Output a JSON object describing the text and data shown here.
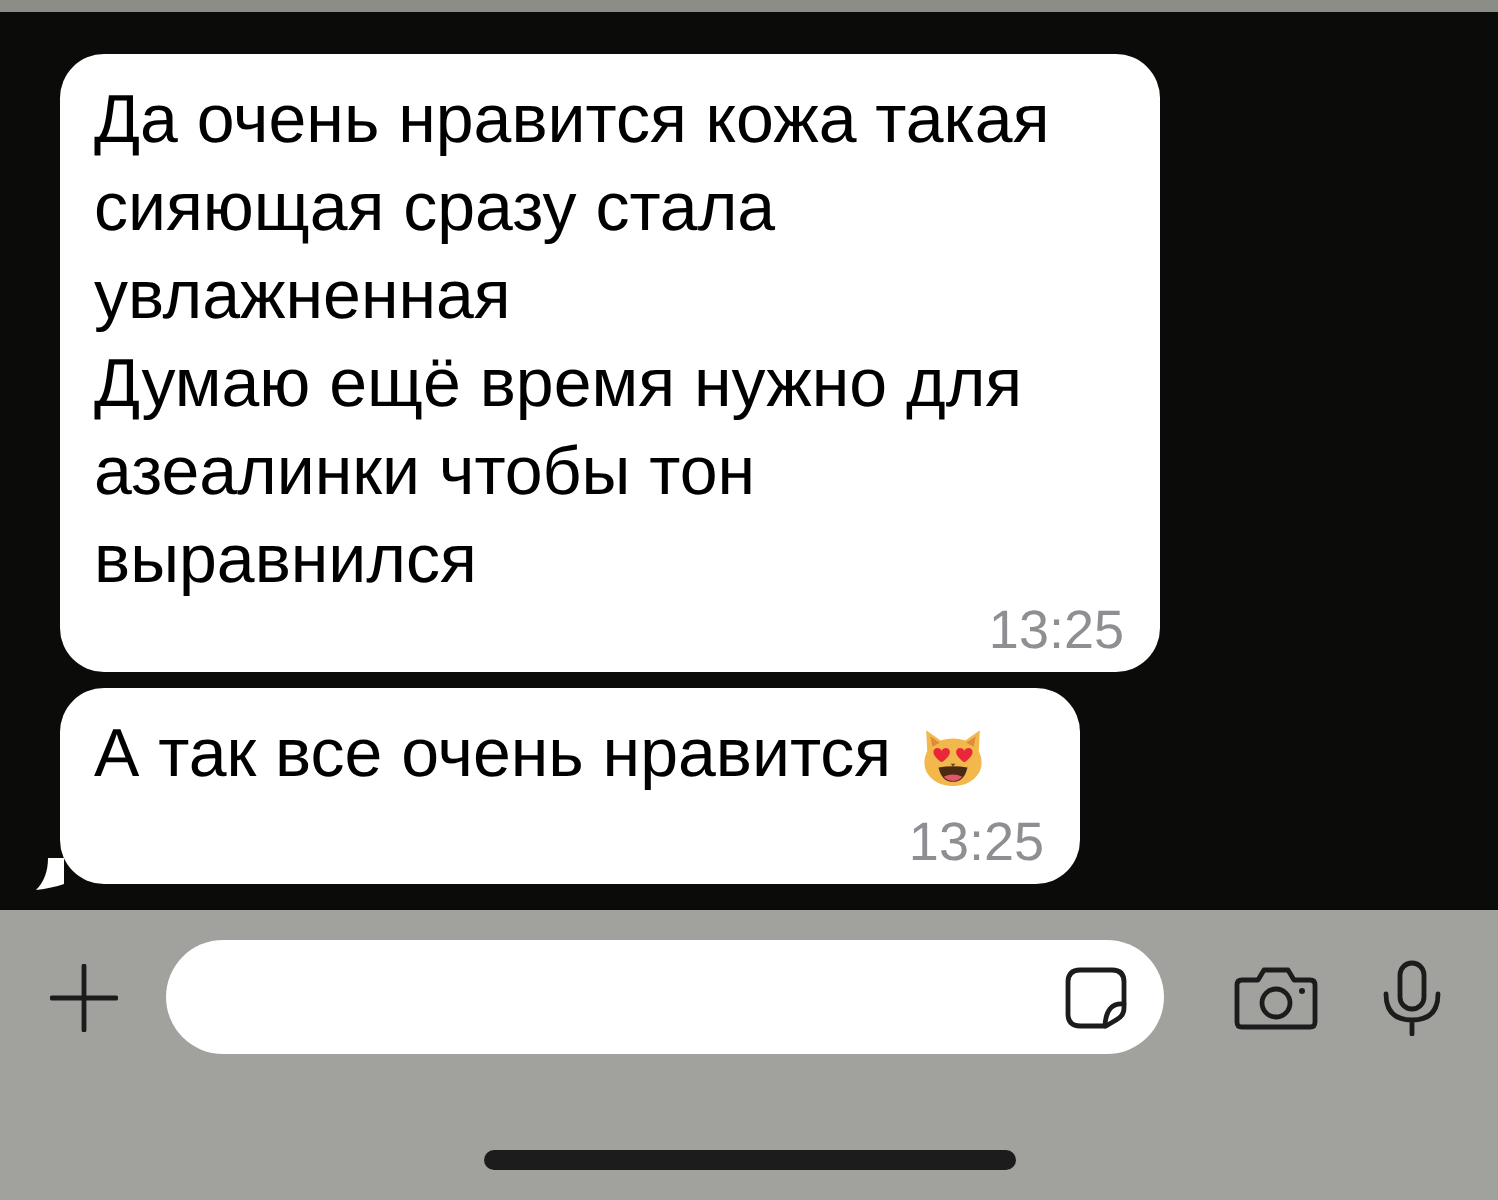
{
  "messages": [
    {
      "text": "Да очень нравится кожа такая\nсияющая сразу стала\nувлажненная\nДумаю ещё время нужно для\nазеалинки чтобы тон\nвыравнился",
      "time": "13:25",
      "kind": "plain",
      "tail": false
    },
    {
      "text": "А так все очень нравится",
      "time": "13:25",
      "kind": "emoji",
      "tail": true
    }
  ]
}
